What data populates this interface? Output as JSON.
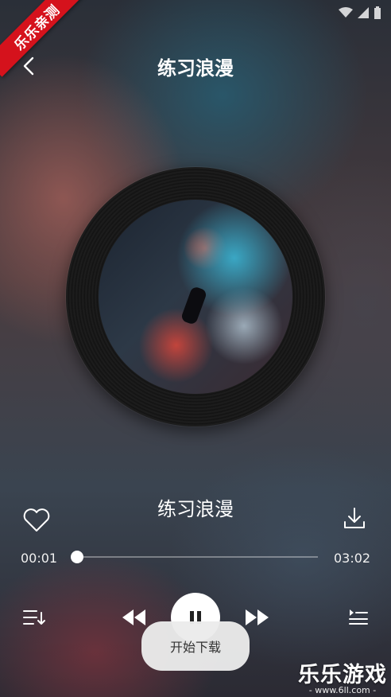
{
  "ribbon": {
    "label": "乐乐亲测"
  },
  "header": {
    "title": "练习浪漫"
  },
  "player": {
    "song_title": "练习浪漫",
    "current_time": "00:01",
    "total_time": "03:02",
    "progress": 0.005
  },
  "toast": {
    "message": "开始下载"
  },
  "watermark": {
    "main": "乐乐游戏",
    "sub": "- www.6ll.com -"
  },
  "icons": {
    "back": "chevron-left-icon",
    "heart": "heart-icon",
    "download": "download-icon",
    "playlist": "playlist-icon",
    "prev": "rewind-icon",
    "pause": "pause-icon",
    "next": "fast-forward-icon",
    "queue": "queue-icon"
  },
  "colors": {
    "ribbon": "#d5121c",
    "toast_bg": "#ebebeb",
    "accent": "#ffffff"
  }
}
